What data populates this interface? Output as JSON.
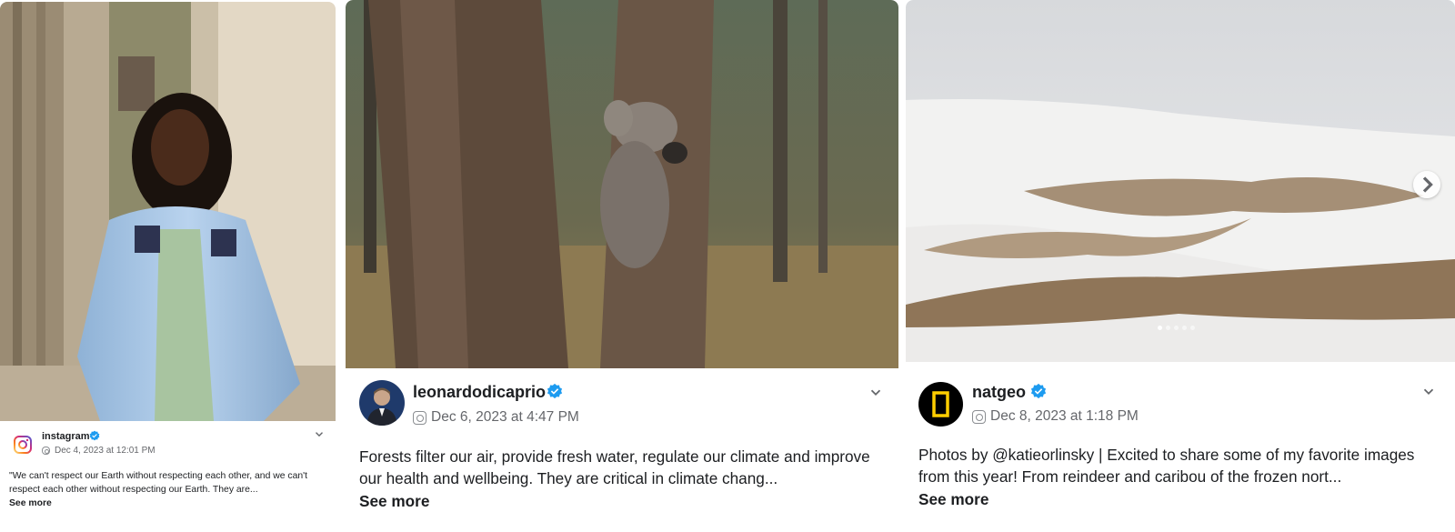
{
  "posts": [
    {
      "username": "instagram",
      "verified": true,
      "timestamp": "Dec 4, 2023 at 12:01 PM",
      "platform_icon": "instagram-icon",
      "caption": "\"We can't respect our Earth without respecting each other, and we can't respect each other without respecting our Earth. They are...",
      "see_more": "See more",
      "photo_icon": "graduate-portrait-photo"
    },
    {
      "username": "leonardodicaprio",
      "verified": true,
      "timestamp": "Dec 6, 2023 at 4:47 PM",
      "platform_icon": "instagram-icon",
      "caption": "Forests filter our air, provide fresh water, regulate our climate and improve our health and wellbeing. They are critical in climate chang...",
      "see_more": "See more",
      "photo_icon": "koala-tree-photo"
    },
    {
      "username": "natgeo",
      "verified": true,
      "timestamp": "Dec 8, 2023 at 1:18 PM",
      "platform_icon": "instagram-icon",
      "caption": "Photos by @katieorlinsky | Excited to share some of my favorite images from this year! From reindeer and caribou of the frozen nort...",
      "see_more": "See more",
      "photo_icon": "reindeer-herd-photo",
      "carousel": {
        "count": 5,
        "active": 0
      }
    }
  ],
  "colors": {
    "verified_badge": "#1d9bf0",
    "secondary_text": "#65676b",
    "natgeo_yellow": "#ffce00",
    "instagram_gradient": [
      "#feda75",
      "#fa7e1e",
      "#d62976",
      "#962fbf",
      "#4f5bd5"
    ]
  }
}
